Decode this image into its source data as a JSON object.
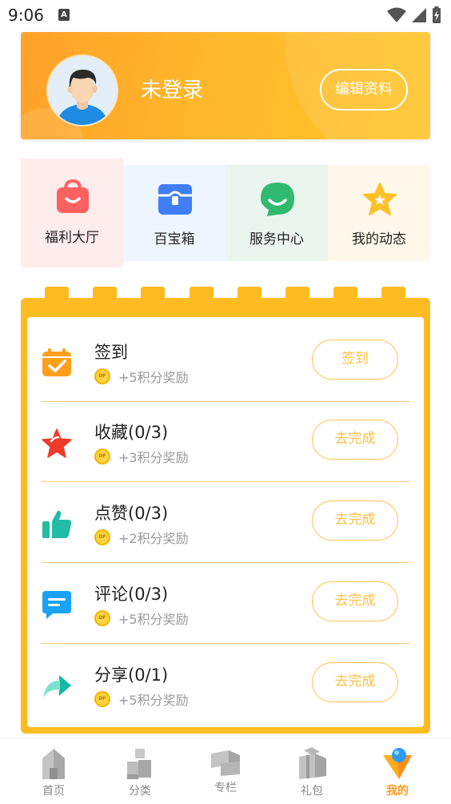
{
  "status_bar": {
    "time": "9:06",
    "icons": [
      "accessibility-a-icon",
      "wifi-icon",
      "signal-icon",
      "battery-charging-icon"
    ]
  },
  "profile": {
    "username": "未登录",
    "edit_label": "编辑资料",
    "avatar_icon": "default-male-avatar"
  },
  "quick_tiles": [
    {
      "label": "福利大厅",
      "icon": "shopping-bag-icon",
      "bg": "#ffecec"
    },
    {
      "label": "百宝箱",
      "icon": "treasure-box-icon",
      "bg": "#eef5ff"
    },
    {
      "label": "服务中心",
      "icon": "chat-smile-icon",
      "bg": "#eaf5ee"
    },
    {
      "label": "我的动态",
      "icon": "star-icon",
      "bg": "#fff8ea"
    }
  ],
  "tasks": [
    {
      "title": "签到",
      "reward": "+5积分奖励",
      "button": "签到",
      "icon": "calendar-check-icon"
    },
    {
      "title": "收藏(0/3)",
      "reward": "+3积分奖励",
      "button": "去完成",
      "icon": "star-icon"
    },
    {
      "title": "点赞(0/3)",
      "reward": "+2积分奖励",
      "button": "去完成",
      "icon": "thumbs-up-icon"
    },
    {
      "title": "评论(0/3)",
      "reward": "+5积分奖励",
      "button": "去完成",
      "icon": "comment-icon"
    },
    {
      "title": "分享(0/1)",
      "reward": "+5积分奖励",
      "button": "去完成",
      "icon": "share-arrow-icon"
    }
  ],
  "coin_label": "DF",
  "bottom_nav": [
    {
      "label": "首页",
      "icon": "home-building-icon",
      "active": false
    },
    {
      "label": "分类",
      "icon": "category-blocks-icon",
      "active": false
    },
    {
      "label": "专栏",
      "icon": "column-blocks-icon",
      "active": false
    },
    {
      "label": "礼包",
      "icon": "gift-box-icon",
      "active": false
    },
    {
      "label": "我的",
      "icon": "profile-funnel-icon",
      "active": true
    }
  ],
  "colors": {
    "accent": "#ffbb22",
    "header_start": "#ffa129",
    "header_end": "#ffc52a",
    "button_text": "#ffbf45",
    "active_nav": "#ff9a1f"
  }
}
